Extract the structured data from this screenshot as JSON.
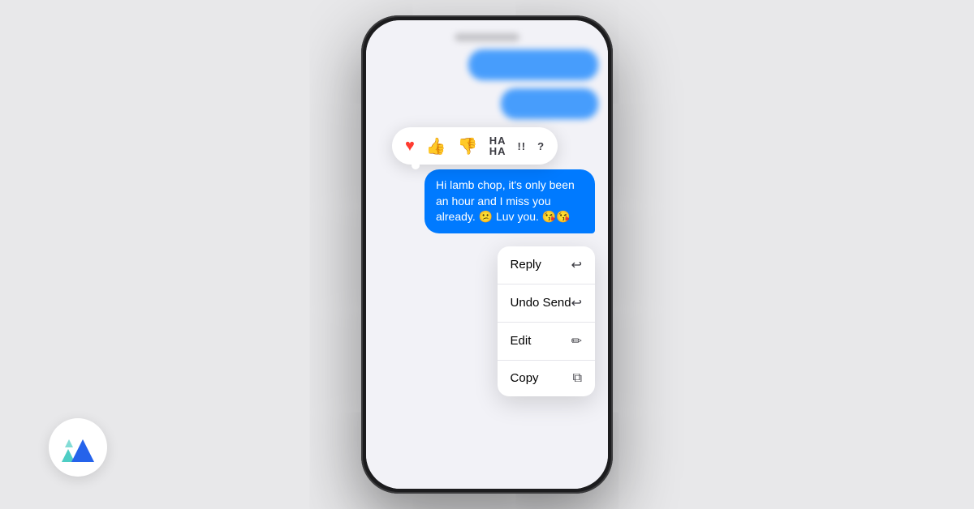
{
  "phone": {
    "messages": {
      "blurred_bubbles": [
        {
          "width": 160,
          "class": "wide"
        },
        {
          "width": 120,
          "class": "medium"
        }
      ],
      "main_bubble_text": "Hi lamb chop, it's only been an hour and I miss you already. 😕 Luv you. 😘😘"
    },
    "reactions": [
      {
        "icon": "♥",
        "label": "heart",
        "type": "heart"
      },
      {
        "icon": "👍",
        "label": "thumbs-up"
      },
      {
        "icon": "👎",
        "label": "thumbs-down"
      },
      {
        "icon": "HA\nHA",
        "label": "haha",
        "isText": true
      },
      {
        "icon": "!!",
        "label": "exclamation",
        "isText": true
      },
      {
        "icon": "?",
        "label": "question",
        "isText": true
      }
    ],
    "context_menu": [
      {
        "label": "Reply",
        "icon": "↩",
        "key": "reply"
      },
      {
        "label": "Undo Send",
        "icon": "↩",
        "key": "undo-send"
      },
      {
        "label": "Edit",
        "icon": "✏",
        "key": "edit"
      },
      {
        "label": "Copy",
        "icon": "⧉",
        "key": "copy"
      }
    ]
  },
  "logo": {
    "alt": "Superpower Logo"
  }
}
